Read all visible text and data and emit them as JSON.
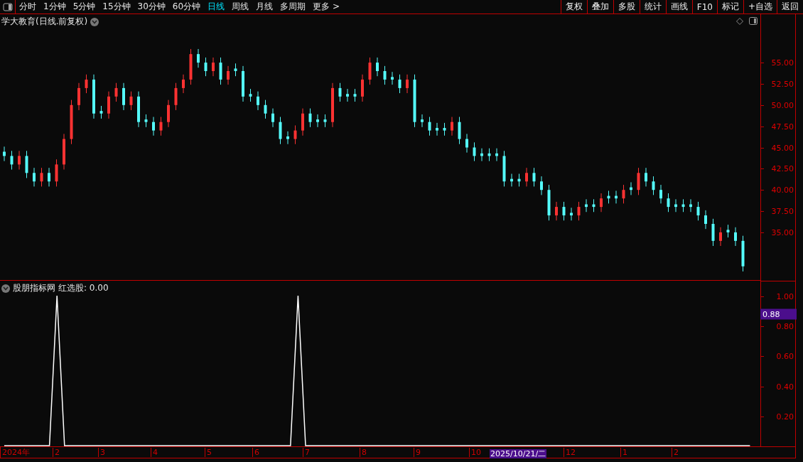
{
  "toolbar": {
    "periods": [
      {
        "label": "分时",
        "selected": false
      },
      {
        "label": "1分钟",
        "selected": false
      },
      {
        "label": "5分钟",
        "selected": false
      },
      {
        "label": "15分钟",
        "selected": false
      },
      {
        "label": "30分钟",
        "selected": false
      },
      {
        "label": "60分钟",
        "selected": false
      },
      {
        "label": "日线",
        "selected": true
      },
      {
        "label": "周线",
        "selected": false
      },
      {
        "label": "月线",
        "selected": false
      },
      {
        "label": "多周期",
        "selected": false
      },
      {
        "label": "更多 >",
        "selected": false
      }
    ],
    "actions": [
      "复权",
      "叠加",
      "多股",
      "统计",
      "画线",
      "F10",
      "标记",
      "+自选",
      "返回"
    ]
  },
  "price_panel": {
    "title": "学大教育(日线.前复权)",
    "chart_data": {
      "type": "candlestick",
      "ylim": [
        29.3,
        60.7
      ],
      "yticks": [
        {
          "value": 55,
          "label": "55.00"
        },
        {
          "value": 52.5,
          "label": "52.50"
        },
        {
          "value": 50,
          "label": "50.00"
        },
        {
          "value": 47.5,
          "label": "47.50"
        },
        {
          "value": 45,
          "label": "45.00"
        },
        {
          "value": 42.5,
          "label": "42.50"
        },
        {
          "value": 40,
          "label": "40.00"
        },
        {
          "value": 37.5,
          "label": "37.50"
        },
        {
          "value": 35,
          "label": "35.00"
        }
      ],
      "ohlc": [
        [
          44.5,
          45.1,
          43.4,
          44
        ],
        [
          44,
          44.6,
          42.4,
          43
        ],
        [
          43,
          44.6,
          42.4,
          44
        ],
        [
          44,
          44.6,
          41.4,
          42
        ],
        [
          42,
          42.6,
          40.4,
          41
        ],
        [
          41,
          42.6,
          40.4,
          42
        ],
        [
          42,
          42.6,
          40.4,
          41
        ],
        [
          41,
          43.6,
          40.4,
          43
        ],
        [
          43,
          46.6,
          42.4,
          46
        ],
        [
          46,
          50.6,
          45.4,
          50
        ],
        [
          50,
          52.6,
          49.4,
          52
        ],
        [
          52,
          53.6,
          51.4,
          53
        ],
        [
          53,
          53.6,
          48.4,
          49
        ],
        [
          49.3,
          49.9,
          48.4,
          49
        ],
        [
          49,
          51.6,
          48.4,
          51
        ],
        [
          51,
          52.6,
          50.4,
          52
        ],
        [
          52,
          52.6,
          49.4,
          50
        ],
        [
          50,
          51.6,
          49.4,
          51
        ],
        [
          51,
          51.6,
          47.4,
          48
        ],
        [
          48.3,
          48.9,
          47.4,
          48
        ],
        [
          48,
          48.6,
          46.4,
          47
        ],
        [
          47,
          48.6,
          46.4,
          48
        ],
        [
          48,
          50.6,
          47.4,
          50
        ],
        [
          50,
          52.6,
          49.4,
          52
        ],
        [
          52,
          53.6,
          51.4,
          53
        ],
        [
          53,
          56.6,
          52.4,
          56
        ],
        [
          56,
          56.6,
          54.4,
          55
        ],
        [
          55,
          55.6,
          53.4,
          54
        ],
        [
          54,
          55.6,
          53.4,
          55
        ],
        [
          55,
          55.6,
          52.4,
          53
        ],
        [
          53,
          54.6,
          52.4,
          54
        ],
        [
          54.3,
          54.9,
          53.4,
          54
        ],
        [
          54,
          54.6,
          50.4,
          51
        ],
        [
          51.3,
          51.9,
          50.4,
          51
        ],
        [
          51,
          51.6,
          49.4,
          50
        ],
        [
          50,
          50.6,
          48.4,
          49
        ],
        [
          49,
          49.6,
          47.4,
          48
        ],
        [
          48,
          48.6,
          45.4,
          46
        ],
        [
          46.3,
          46.9,
          45.4,
          46
        ],
        [
          46,
          47.6,
          45.4,
          47
        ],
        [
          47,
          49.6,
          46.4,
          49
        ],
        [
          49,
          49.6,
          47.4,
          48
        ],
        [
          48.3,
          48.9,
          47.4,
          48
        ],
        [
          48.3,
          48.9,
          47.4,
          48
        ],
        [
          48,
          52.6,
          47.4,
          52
        ],
        [
          52,
          52.6,
          50.4,
          51
        ],
        [
          51.3,
          51.9,
          50.4,
          51
        ],
        [
          51.3,
          51.9,
          50.4,
          51
        ],
        [
          51,
          53.6,
          50.4,
          53
        ],
        [
          53,
          55.6,
          52.4,
          55
        ],
        [
          55,
          55.6,
          53.4,
          54
        ],
        [
          54,
          54.6,
          52.4,
          53
        ],
        [
          53.3,
          53.9,
          52.4,
          53
        ],
        [
          53,
          53.6,
          51.4,
          52
        ],
        [
          52,
          53.6,
          51.4,
          53
        ],
        [
          53,
          53.6,
          47.4,
          48
        ],
        [
          48.3,
          48.9,
          47.4,
          48
        ],
        [
          48,
          48.6,
          46.4,
          47
        ],
        [
          47.3,
          47.9,
          46.4,
          47
        ],
        [
          47.3,
          47.9,
          46.4,
          47
        ],
        [
          47,
          48.6,
          46.4,
          48
        ],
        [
          48,
          48.6,
          45.4,
          46
        ],
        [
          46,
          46.6,
          44.4,
          45
        ],
        [
          45,
          45.6,
          43.4,
          44
        ],
        [
          44.3,
          44.9,
          43.4,
          44
        ],
        [
          44.3,
          44.9,
          43.4,
          44
        ],
        [
          44.3,
          44.9,
          43.4,
          44
        ],
        [
          44,
          44.6,
          40.4,
          41
        ],
        [
          41.3,
          41.9,
          40.4,
          41
        ],
        [
          41.3,
          41.9,
          40.4,
          41
        ],
        [
          41,
          42.6,
          40.4,
          42
        ],
        [
          42,
          42.6,
          40.4,
          41
        ],
        [
          41,
          41.6,
          39.4,
          40
        ],
        [
          40,
          40.6,
          36.4,
          37
        ],
        [
          37,
          38.6,
          36.4,
          38
        ],
        [
          38,
          38.6,
          36.4,
          37
        ],
        [
          37.3,
          37.9,
          36.4,
          37
        ],
        [
          37,
          38.6,
          36.4,
          38
        ],
        [
          38.3,
          38.9,
          37.4,
          38
        ],
        [
          38.3,
          38.9,
          37.4,
          38
        ],
        [
          38,
          39.6,
          37.4,
          39
        ],
        [
          39.3,
          39.9,
          38.4,
          39
        ],
        [
          39.3,
          39.9,
          38.4,
          39
        ],
        [
          39,
          40.6,
          38.4,
          40
        ],
        [
          40.3,
          40.9,
          39.4,
          40
        ],
        [
          40,
          42.6,
          39.4,
          42
        ],
        [
          42,
          42.6,
          40.4,
          41
        ],
        [
          41,
          41.6,
          39.4,
          40
        ],
        [
          40,
          40.6,
          38.4,
          39
        ],
        [
          39,
          39.6,
          37.4,
          38
        ],
        [
          38.3,
          38.9,
          37.4,
          38
        ],
        [
          38.3,
          38.9,
          37.4,
          38
        ],
        [
          38.3,
          38.9,
          37.4,
          38
        ],
        [
          38,
          38.6,
          36.4,
          37
        ],
        [
          37,
          37.6,
          35.4,
          36
        ],
        [
          36,
          36.6,
          33.4,
          34
        ],
        [
          34,
          35.6,
          33.4,
          35
        ],
        [
          35.3,
          35.9,
          34.4,
          35
        ],
        [
          35,
          35.6,
          33.4,
          34
        ],
        [
          34,
          34.6,
          30.4,
          31
        ]
      ]
    }
  },
  "indicator_panel": {
    "name": "股朋指标网",
    "reading": "红选股: 0.00",
    "cursor_value": "0.88",
    "chart_data": {
      "type": "line",
      "ylim": [
        0,
        1.1
      ],
      "yticks": [
        {
          "value": 1,
          "label": "1.00"
        },
        {
          "value": 0.8,
          "label": "0.80"
        },
        {
          "value": 0.6,
          "label": "0.60"
        },
        {
          "value": 0.4,
          "label": "0.40"
        },
        {
          "value": 0.2,
          "label": "0.20"
        }
      ],
      "series": [
        {
          "color": "#ffffff",
          "values": [
            0,
            0,
            0,
            0,
            0,
            0,
            0,
            1,
            0,
            0,
            0,
            0,
            0,
            0,
            0,
            0,
            0,
            0,
            0,
            0,
            0,
            0,
            0,
            0,
            0,
            0,
            0,
            0,
            0,
            0,
            0,
            0,
            0,
            0,
            0,
            0,
            0,
            0,
            0,
            1,
            0,
            0,
            0,
            0,
            0,
            0,
            0,
            0,
            0,
            0,
            0,
            0,
            0,
            0,
            0,
            0,
            0,
            0,
            0,
            0,
            0,
            0,
            0,
            0,
            0,
            0,
            0,
            0,
            0,
            0,
            0,
            0,
            0,
            0,
            0,
            0,
            0,
            0,
            0,
            0,
            0,
            0,
            0,
            0,
            0,
            0,
            0,
            0,
            0,
            0,
            0,
            0,
            0,
            0,
            0,
            0,
            0,
            0,
            0,
            0
          ]
        }
      ]
    }
  },
  "date_axis": [
    {
      "label": "2024年",
      "kind": "month"
    },
    {
      "label": "2",
      "kind": "month"
    },
    {
      "label": "3",
      "kind": "month"
    },
    {
      "label": "4",
      "kind": "month"
    },
    {
      "label": "5",
      "kind": "month"
    },
    {
      "label": "6",
      "kind": "month"
    },
    {
      "label": "7",
      "kind": "month"
    },
    {
      "label": "8",
      "kind": "month"
    },
    {
      "label": "9",
      "kind": "month"
    },
    {
      "label": "10",
      "kind": "month"
    },
    {
      "label": "2025/10/21/二",
      "kind": "cursor"
    },
    {
      "label": "12",
      "kind": "month"
    },
    {
      "label": "1",
      "kind": "month"
    },
    {
      "label": "2",
      "kind": "month"
    }
  ]
}
